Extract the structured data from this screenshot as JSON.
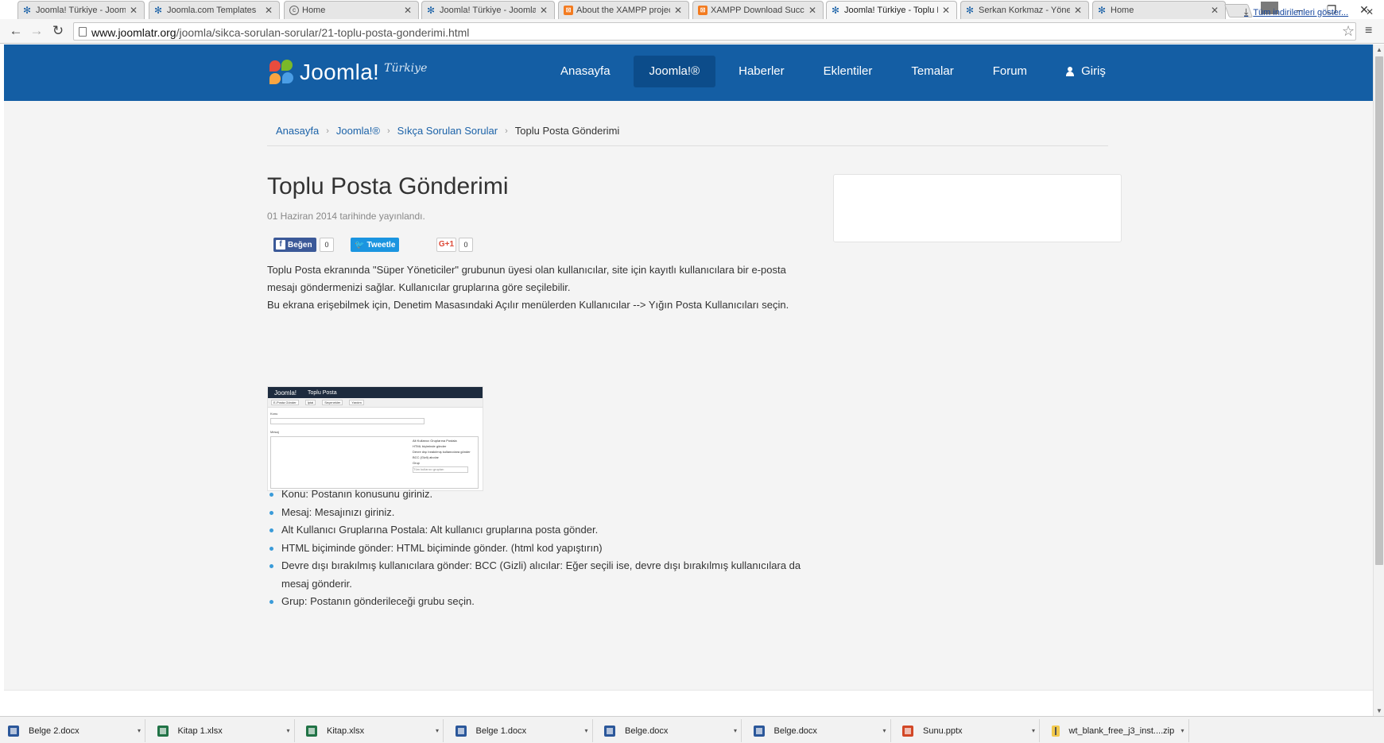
{
  "browser": {
    "tabs": [
      {
        "title": "Joomla! Türkiye - Joomla!",
        "icon": "joomla-icon"
      },
      {
        "title": "Joomla.com Templates",
        "icon": "joomla-icon"
      },
      {
        "title": "Home",
        "icon": "home-icon"
      },
      {
        "title": "Joomla! Türkiye - Joomla!",
        "icon": "joomla-icon"
      },
      {
        "title": "About the XAMPP project",
        "icon": "xampp-icon"
      },
      {
        "title": "XAMPP Download Success",
        "icon": "xampp-icon"
      },
      {
        "title": "Joomla! Türkiye - Toplu P",
        "icon": "joomla-icon",
        "active": true
      },
      {
        "title": "Serkan Korkmaz - Yönetim",
        "icon": "joomla-icon"
      },
      {
        "title": "Home",
        "icon": "joomla-icon"
      }
    ],
    "tab_close": "✕",
    "window_controls": {
      "minimize": "–",
      "restore": "❐",
      "close": "✕"
    },
    "nav": {
      "back": "←",
      "forward": "→",
      "reload": "↻"
    },
    "url_host": "www.joomlatr.org",
    "url_path": "/joomla/sikca-sorulan-sorular/21-toplu-posta-gonderimi.html",
    "star": "☆",
    "menu": "≡"
  },
  "site": {
    "logo_text": "Joomla!",
    "logo_sub": "Türkiye",
    "nav": [
      {
        "label": "Anasayfa"
      },
      {
        "label": "Joomla!®",
        "active": true
      },
      {
        "label": "Haberler"
      },
      {
        "label": "Eklentiler"
      },
      {
        "label": "Temalar"
      },
      {
        "label": "Forum"
      }
    ],
    "login_label": "Giriş"
  },
  "breadcrumb": {
    "items": [
      "Anasayfa",
      "Joomla!®",
      "Sıkça Sorulan Sorular"
    ],
    "current": "Toplu Posta Gönderimi",
    "separator": "›"
  },
  "article": {
    "title": "Toplu Posta Gönderimi",
    "date": "01 Haziran 2014 tarihinde yayınlandı.",
    "share": {
      "fb_label": "Beğen",
      "fb_count": "0",
      "tw_label": "Tweetle",
      "gp_label": "G+1",
      "gp_count": "0"
    },
    "para1": "Toplu Posta ekranında \"Süper Yöneticiler\" grubunun üyesi olan kullanıcılar, site için kayıtlı kullanıcılara bir e-posta mesajı göndermenizi sağlar. Kullanıcılar gruplarına göre seçilebilir.",
    "para2": "Bu ekrana erişebilmek için, Denetim Masasındaki Açılır menülerden Kullanıcılar --> Yığın Posta Kullanıcıları seçin.",
    "thumbnail": {
      "logo": "Joomla!",
      "title": "Toplu Posta",
      "toolbar": [
        "E-Posta Gönder",
        "İptal",
        "Seçenekler",
        "Yardım"
      ],
      "label_subject": "Konu",
      "label_message": "Mesaj",
      "options": [
        "Alt Kullanıcı Gruplarına Postala",
        "HTML biçiminde gönder",
        "Devre dışı bırakılmış kullanıcılara gönder",
        "BCC (Gizli) alıcılar"
      ],
      "group_label": "Grup",
      "group_value": "Tüm kullanıcı grupları"
    },
    "bullets": [
      "Konu: Postanın konusunu giriniz.",
      "Mesaj: Mesajınızı giriniz.",
      "Alt Kullanıcı Gruplarına Postala: Alt kullanıcı gruplarına posta gönder.",
      "HTML biçiminde gönder: HTML biçiminde gönder. (html kod yapıştırın)",
      "Devre dışı bırakılmış kullanıcılara gönder: BCC (Gizli) alıcılar: Eğer seçili ise, devre dışı bırakılmış kullanıcılara da mesaj gönderir.",
      "Grup: Postanın gönderileceği grubu seçin."
    ]
  },
  "downloads": {
    "items": [
      {
        "name": "Belge 2.docx",
        "type": "word"
      },
      {
        "name": "Kitap 1.xlsx",
        "type": "excel"
      },
      {
        "name": "Kitap.xlsx",
        "type": "excel"
      },
      {
        "name": "Belge 1.docx",
        "type": "word"
      },
      {
        "name": "Belge.docx",
        "type": "word"
      },
      {
        "name": "Belge.docx",
        "type": "word"
      },
      {
        "name": "Sunu.pptx",
        "type": "ppt"
      },
      {
        "name": "wt_blank_free_j3_inst....zip",
        "type": "zip"
      }
    ],
    "caret": "▾",
    "show_all": "Tüm indirilenleri göster...",
    "close": "✕"
  }
}
